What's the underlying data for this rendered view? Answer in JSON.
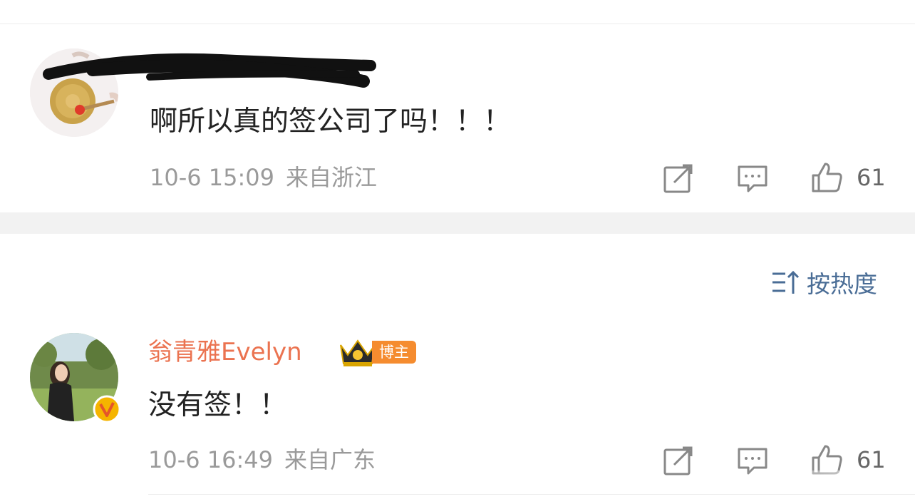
{
  "comments": [
    {
      "username": "",
      "text": "啊所以真的签公司了吗！！！",
      "date": "10-6 15:09",
      "location": "来自浙江",
      "likes": "61",
      "icons": [
        "share-icon",
        "comment-icon",
        "like-icon"
      ]
    },
    {
      "username": "翁青雅Evelyn",
      "badge": "博主",
      "text": "没有签！！",
      "date": "10-6 16:49",
      "location": "来自广东",
      "likes": "61",
      "icons": [
        "share-icon",
        "comment-icon",
        "like-icon"
      ]
    }
  ],
  "sort": {
    "label": "按热度",
    "icon": "sort-icon"
  },
  "colors": {
    "username_vip": "#eb7350",
    "badge_bg": "#f58c2f",
    "meta_text": "#9a9a9a",
    "sort_blue": "#4a6d96",
    "verified_badge": "#f5b400"
  }
}
